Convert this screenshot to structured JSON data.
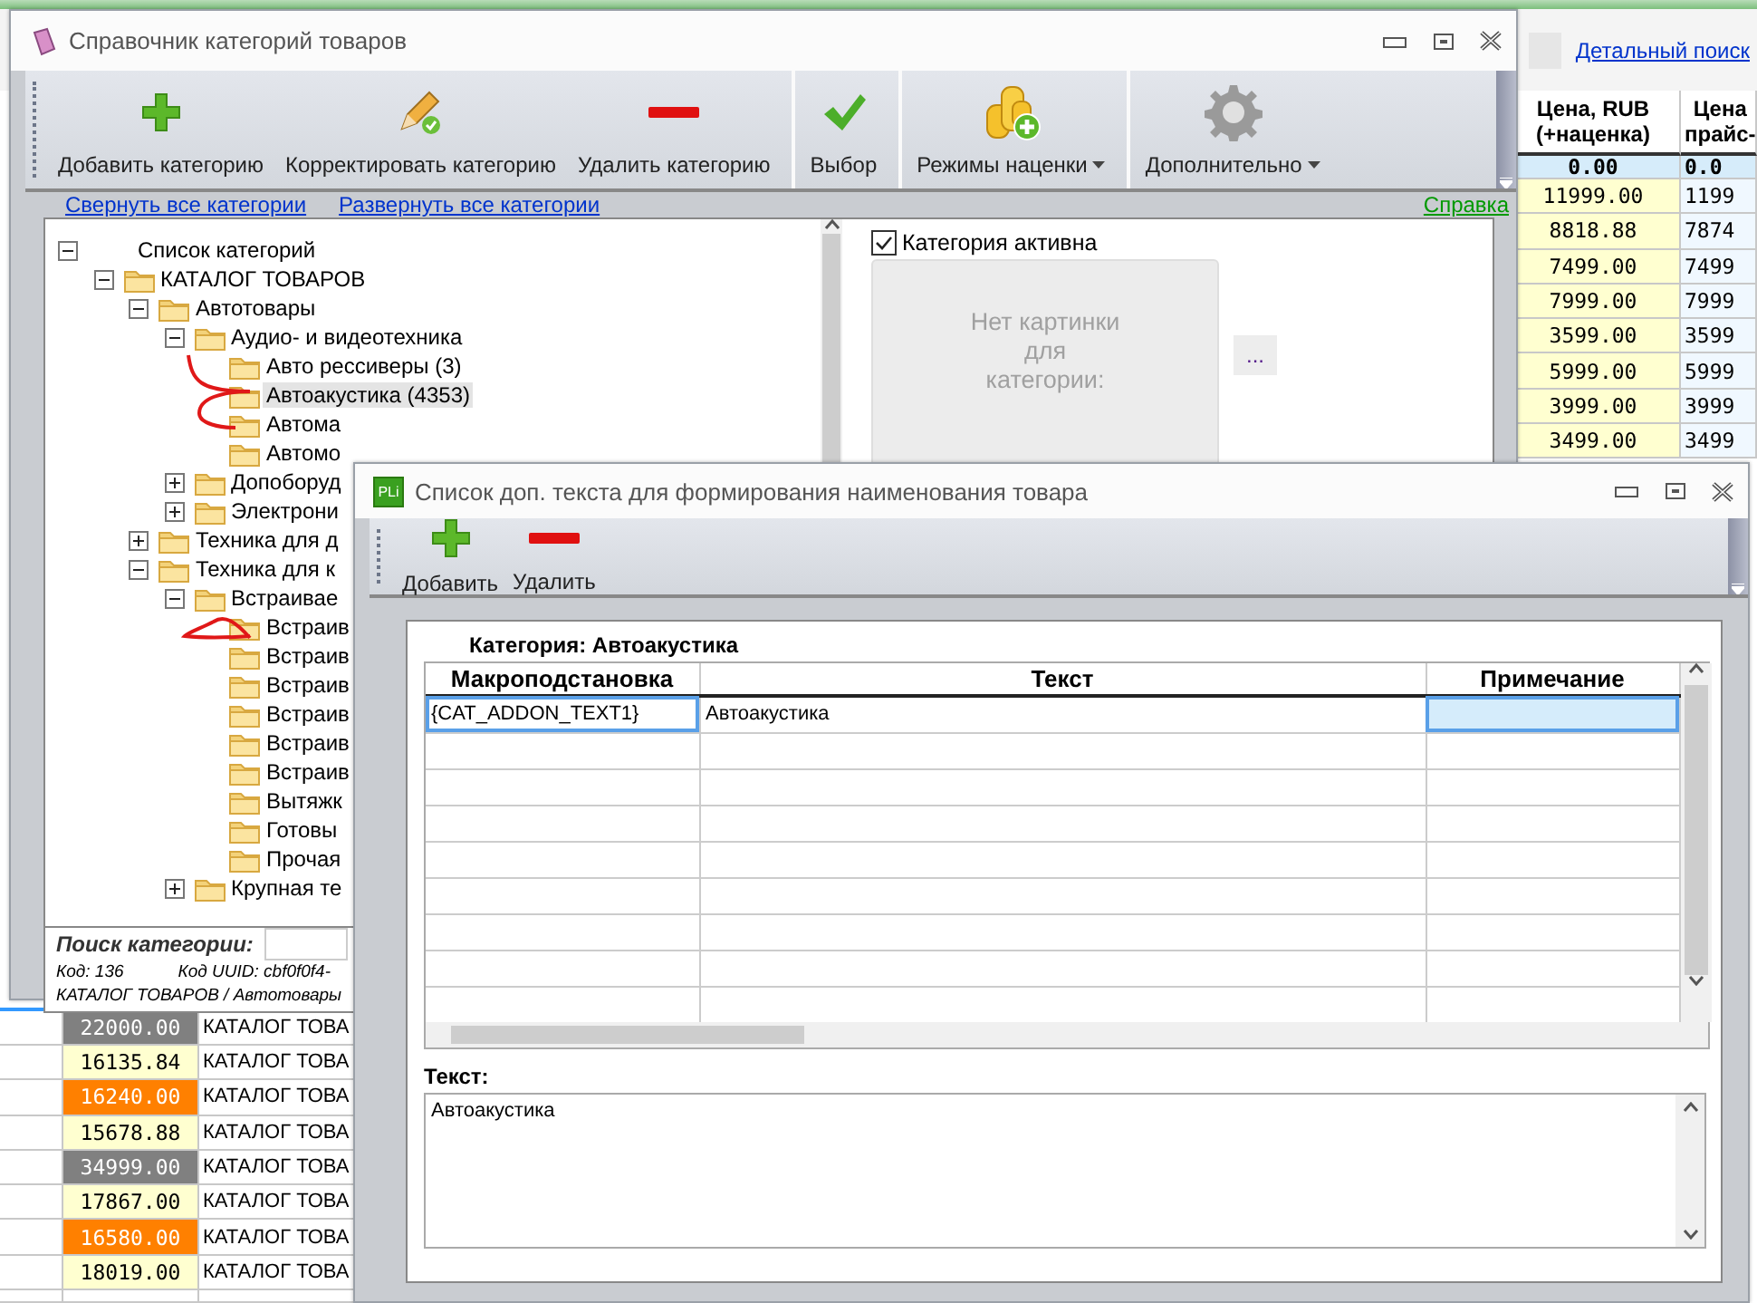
{
  "background_app": {
    "search_link": "Детальный поиск",
    "price_table": {
      "columns": [
        "Цена, RUB\n(+наценка)",
        "Цена\nпрайс-"
      ],
      "total": [
        "0.00",
        "0.0"
      ],
      "rows": [
        [
          "11999.00",
          "1199"
        ],
        [
          "8818.88",
          "7874"
        ],
        [
          "7499.00",
          "7499"
        ],
        [
          "7999.00",
          "7999"
        ],
        [
          "3599.00",
          "3599"
        ],
        [
          "5999.00",
          "5999"
        ],
        [
          "3999.00",
          "3999"
        ],
        [
          "3499.00",
          "3499"
        ]
      ]
    },
    "lower_rows": [
      {
        "price": "22000.00",
        "color": "#808080",
        "category": "КАТАЛОГ ТОВА"
      },
      {
        "price": "16135.84",
        "color": "#ffffd0",
        "category": "КАТАЛОГ ТОВА"
      },
      {
        "price": "16240.00",
        "color": "#ff8000",
        "category": "КАТАЛОГ ТОВА"
      },
      {
        "price": "15678.88",
        "color": "#ffffd0",
        "category": "КАТАЛОГ ТОВА"
      },
      {
        "price": "34999.00",
        "color": "#808080",
        "category": "КАТАЛОГ ТОВА"
      },
      {
        "price": "17867.00",
        "color": "#ffffd0",
        "category": "КАТАЛОГ ТОВА"
      },
      {
        "price": "16580.00",
        "color": "#ff8000",
        "category": "КАТАЛОГ ТОВА"
      },
      {
        "price": "18019.00",
        "color": "#ffffd0",
        "category": "КАТАЛОГ ТОВА"
      }
    ]
  },
  "category_window": {
    "title": "Справочник категорий товаров",
    "toolbar": [
      {
        "label": "Добавить категорию",
        "kind": "add",
        "dropdown": false,
        "separator_before": false
      },
      {
        "label": "Корректировать категорию",
        "kind": "edit",
        "dropdown": false,
        "separator_before": false
      },
      {
        "label": "Удалить категорию",
        "kind": "delete",
        "dropdown": false,
        "separator_before": false
      },
      {
        "label": "Выбор",
        "kind": "choose",
        "dropdown": false,
        "separator_before": true
      },
      {
        "label": "Режимы наценки",
        "kind": "markup",
        "dropdown": true,
        "separator_before": true
      },
      {
        "label": "Дополнительно",
        "kind": "settings",
        "dropdown": true,
        "separator_before": true
      }
    ],
    "links": [
      "Свернуть все категории",
      "Развернуть все категории"
    ],
    "help_link": "Справка",
    "tree": [
      {
        "label": "Список категорий",
        "kind": "root",
        "expanded": true,
        "selected": false,
        "children": [
          {
            "label": "КАТАЛОГ ТОВАРОВ",
            "kind": "folder",
            "expanded": true,
            "selected": false,
            "children": [
              {
                "label": "Автотовары",
                "kind": "folder",
                "expanded": true,
                "selected": false,
                "children": [
                  {
                    "label": "Аудио- и видеотехника",
                    "kind": "folder",
                    "expanded": true,
                    "selected": false,
                    "children": [
                      {
                        "label": "Авто рессиверы (3)",
                        "kind": "folder",
                        "selected": false
                      },
                      {
                        "label": "Автоакустика (4353)",
                        "kind": "folder",
                        "selected": true
                      },
                      {
                        "label": "Автома",
                        "kind": "folder",
                        "selected": false
                      },
                      {
                        "label": "Автомо",
                        "kind": "folder",
                        "selected": false
                      }
                    ]
                  },
                  {
                    "label": "Допоборуд",
                    "kind": "folder",
                    "expanded": false,
                    "selected": false
                  },
                  {
                    "label": "Электрони",
                    "kind": "folder",
                    "expanded": false,
                    "selected": false
                  }
                ]
              },
              {
                "label": "Техника для д",
                "kind": "folder",
                "expanded": false,
                "selected": false
              },
              {
                "label": "Техника для к",
                "kind": "folder",
                "expanded": true,
                "selected": false,
                "children": [
                  {
                    "label": "Встраивае",
                    "kind": "folder",
                    "expanded": true,
                    "selected": false,
                    "children": [
                      {
                        "label": "Встраив",
                        "kind": "folder",
                        "selected": false
                      },
                      {
                        "label": "Встраив",
                        "kind": "folder",
                        "selected": false
                      },
                      {
                        "label": "Встраив",
                        "kind": "folder",
                        "selected": false
                      },
                      {
                        "label": "Встраив",
                        "kind": "folder",
                        "selected": false
                      },
                      {
                        "label": "Встраив",
                        "kind": "folder",
                        "selected": false
                      },
                      {
                        "label": "Встраив",
                        "kind": "folder",
                        "selected": false
                      },
                      {
                        "label": "Вытяжк",
                        "kind": "folder",
                        "selected": false
                      },
                      {
                        "label": "Готовы",
                        "kind": "folder",
                        "selected": false
                      },
                      {
                        "label": "Прочая",
                        "kind": "folder",
                        "selected": false
                      }
                    ]
                  },
                  {
                    "label": "Крупная те",
                    "kind": "folder",
                    "expanded": false,
                    "selected": false
                  }
                ]
              }
            ]
          }
        ]
      }
    ],
    "active_checkbox": {
      "label": "Категория активна",
      "checked": true
    },
    "image_placeholder": "Нет картинки для категории:",
    "browse_button": "...",
    "search": {
      "label": "Поиск категории:"
    },
    "code": "Код: 136",
    "uuid": "Код UUID: cbf0f0f4-",
    "path": "КАТАЛОГ ТОВАРОВ / Автотовары"
  },
  "text_dialog": {
    "app_icon_text": "PLi",
    "title": "Список доп. текста для формирования наименования товара",
    "toolbar": [
      {
        "label": "Добавить",
        "kind": "add"
      },
      {
        "label": "Удалить",
        "kind": "delete"
      }
    ],
    "category_label": "Категория: Автоакустика",
    "table": {
      "columns": [
        "Макроподстановка",
        "Текст",
        "Примечание"
      ],
      "rows": [
        {
          "macro": "{CAT_ADDON_TEXT1}",
          "text": "Автоакустика",
          "selected": true
        }
      ]
    },
    "text_label": "Текст:",
    "text_value": "Автоакустика"
  }
}
